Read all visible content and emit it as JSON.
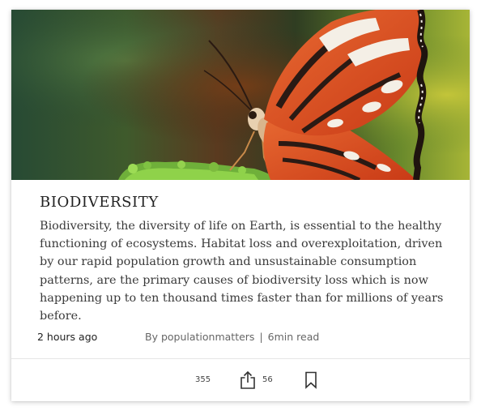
{
  "article": {
    "title": "BIODIVERSITY",
    "excerpt": "Biodiversity, the diversity of life on Earth, is essential to the healthy functioning of ecosystems. Habitat loss and overexploitation, driven by our rapid population growth and unsustainable consumption patterns, are the primary causes of biodiversity loss which is now happening up to ten thousand times faster than for millions of years before.",
    "time_ago": "2 hours ago",
    "author": "By populationmatters",
    "separator": "|",
    "read_time": "6min read",
    "hero_image": "butterfly-photo"
  },
  "actions": {
    "like_count": "355",
    "share_count": "56",
    "share_icon": "share-icon",
    "bookmark_icon": "bookmark-icon"
  },
  "colors": {
    "butterfly_orange": "#d8471e",
    "foliage_green": "#5f9a2a",
    "text_dark": "#222222",
    "text_muted": "#666666"
  }
}
